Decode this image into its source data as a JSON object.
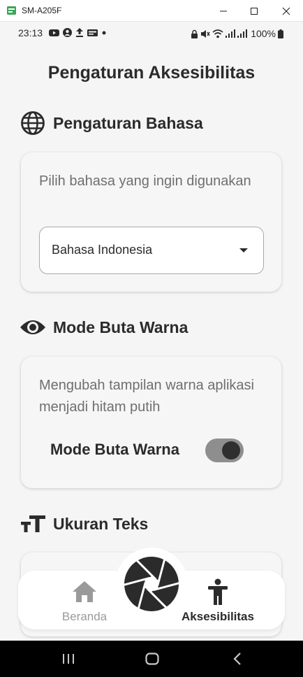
{
  "window": {
    "title": "SM-A205F",
    "app_icon_color": "#3aa657"
  },
  "statusbar": {
    "time": "23:13",
    "battery": "100%"
  },
  "page": {
    "title": "Pengaturan Aksesibilitas"
  },
  "language_section": {
    "title": "Pengaturan Bahasa",
    "icon": "globe-icon",
    "description": "Pilih bahasa yang ingin digunakan",
    "selected_language": "Bahasa Indonesia"
  },
  "colorblind_section": {
    "title": "Mode Buta Warna",
    "icon": "eye-icon",
    "description": "Mengubah tampilan warna aplikasi menjadi hitam putih",
    "toggle_label": "Mode Buta Warna",
    "toggle_on": true
  },
  "text_size_section": {
    "title": "Ukuran Teks",
    "icon": "text-size-icon"
  },
  "bottom_nav": {
    "home_label": "Beranda",
    "accessibility_label": "Aksesibilitas",
    "active": "Aksesibilitas",
    "center_button_icon": "camera-shutter-icon"
  },
  "colors": {
    "text_primary": "#2b2b2b",
    "text_secondary": "#6f6f6f",
    "background": "#f5f5f5",
    "inactive_nav": "#9a9a9a",
    "toggle_track": "#8e8e8e",
    "toggle_knob": "#2f2f2f"
  }
}
